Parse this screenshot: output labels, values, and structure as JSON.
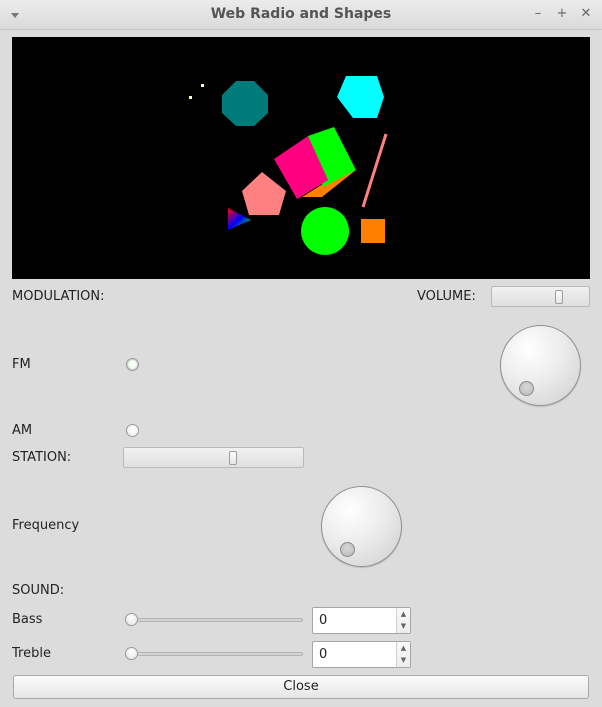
{
  "window": {
    "title": "Web Radio and Shapes",
    "controls": {
      "minimize": "–",
      "maximize": "+",
      "close": "✕"
    }
  },
  "canvas": {
    "background": "#000000",
    "shapes": [
      {
        "name": "small-square-1",
        "color": "#ffffcc"
      },
      {
        "name": "small-square-2",
        "color": "#ffffcc"
      },
      {
        "name": "octagon",
        "color": "#007b7b"
      },
      {
        "name": "hexagon",
        "color": "#00ffff"
      },
      {
        "name": "cube",
        "colors": [
          "#ff0080",
          "#00ff00",
          "#ff8000"
        ]
      },
      {
        "name": "line",
        "color": "#ff8080"
      },
      {
        "name": "pentagon",
        "color": "#ff8080"
      },
      {
        "name": "triangle-gradient",
        "colors": [
          "#ff0000",
          "#00ff00",
          "#0000ff"
        ]
      },
      {
        "name": "circle",
        "color": "#00ff00"
      },
      {
        "name": "square",
        "color": "#ff8000"
      }
    ]
  },
  "labels": {
    "modulation": "MODULATION:",
    "volume": "VOLUME:",
    "fm": "FM",
    "am": "AM",
    "station": "STATION:",
    "frequency": "Frequency",
    "sound": "SOUND:",
    "bass": "Bass",
    "treble": "Treble"
  },
  "controls": {
    "bass_value": "0",
    "treble_value": "0",
    "volume_level": 0.68,
    "station_level": 0.6,
    "fm_selected": false,
    "am_selected": false
  },
  "close_button": "Close"
}
